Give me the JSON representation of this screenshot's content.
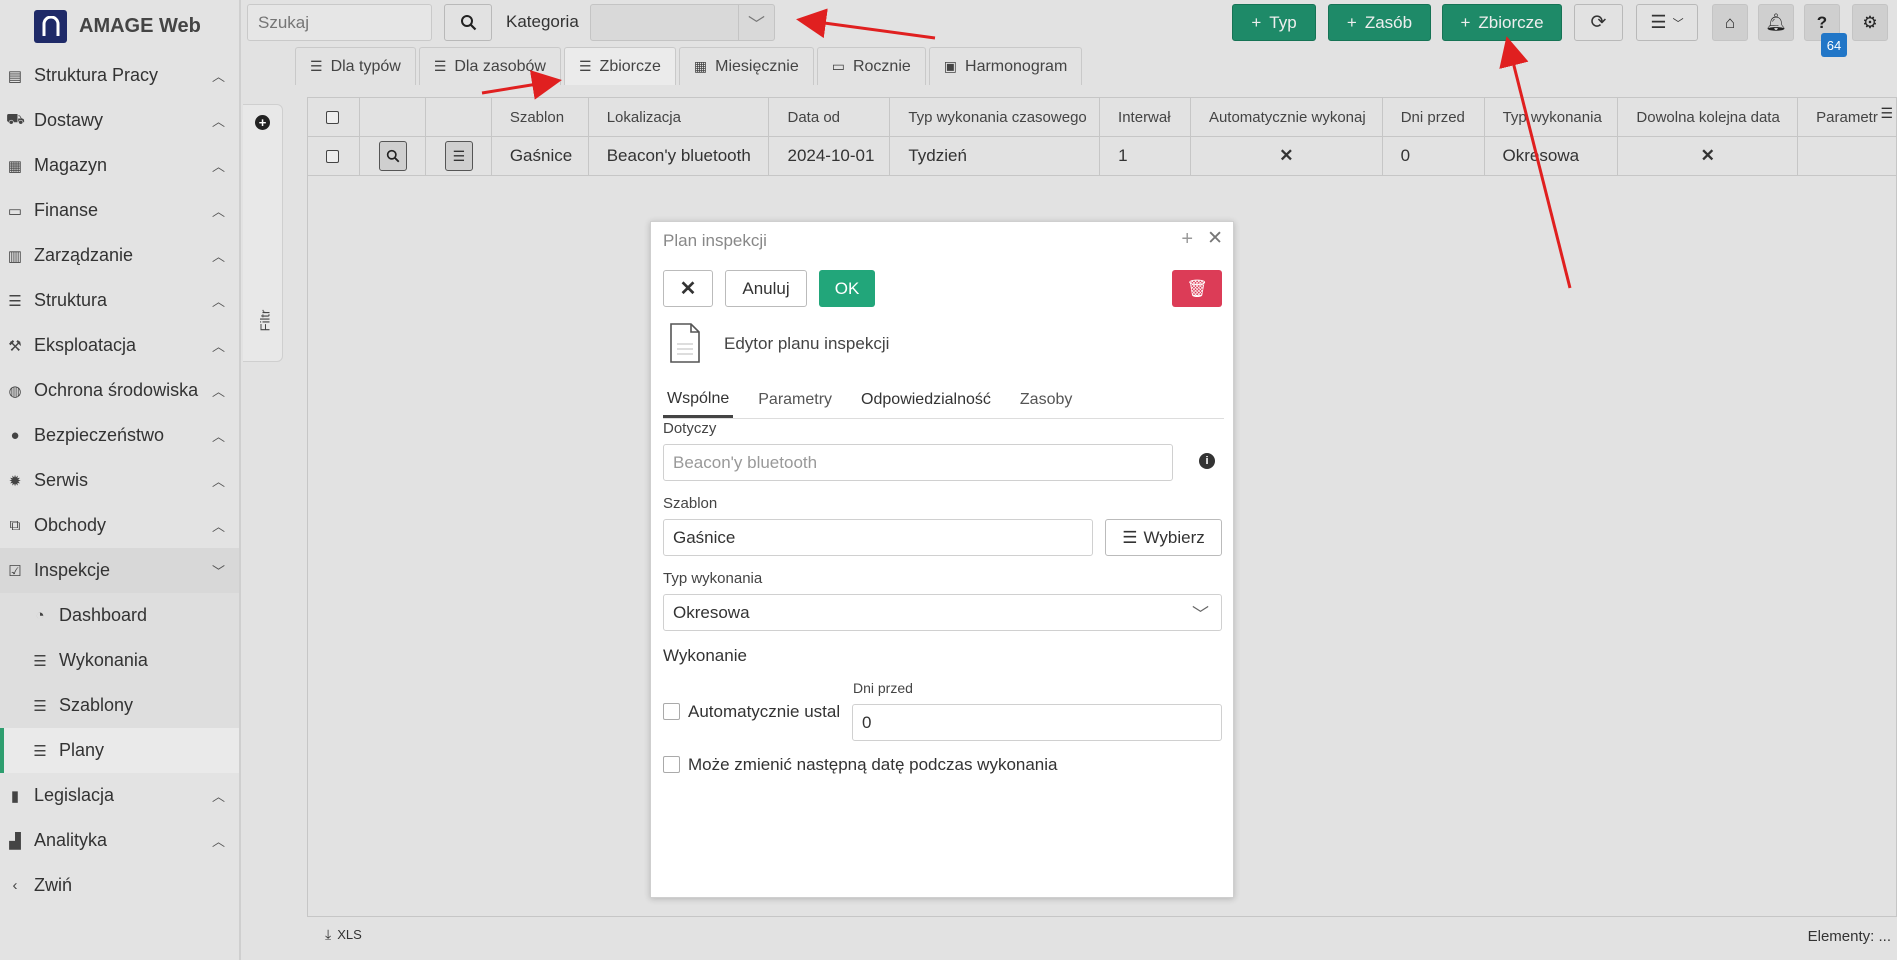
{
  "app": {
    "title": "AMAGE Web"
  },
  "sidebar": {
    "items": [
      {
        "label": "Struktura Pracy",
        "icon": "tasks-icon"
      },
      {
        "label": "Dostawy",
        "icon": "truck-icon"
      },
      {
        "label": "Magazyn",
        "icon": "warehouse-icon"
      },
      {
        "label": "Finanse",
        "icon": "money-icon"
      },
      {
        "label": "Zarządzanie",
        "icon": "building-icon"
      },
      {
        "label": "Struktura",
        "icon": "list-icon"
      },
      {
        "label": "Eksploatacja",
        "icon": "tool-icon"
      },
      {
        "label": "Ochrona środowiska",
        "icon": "globe-icon"
      },
      {
        "label": "Bezpieczeństwo",
        "icon": "user-shield-icon"
      },
      {
        "label": "Serwis",
        "icon": "bug-icon"
      },
      {
        "label": "Obchody",
        "icon": "route-icon"
      },
      {
        "label": "Inspekcje",
        "icon": "check-square-icon"
      },
      {
        "label": "Dashboard",
        "icon": "gauge-icon"
      },
      {
        "label": "Wykonania",
        "icon": "list-icon"
      },
      {
        "label": "Szablony",
        "icon": "list-icon"
      },
      {
        "label": "Plany",
        "icon": "list-icon"
      },
      {
        "label": "Legislacja",
        "icon": "book-icon"
      },
      {
        "label": "Analityka",
        "icon": "chart-icon"
      },
      {
        "label": "Zwiń",
        "icon": "chevron-left-icon"
      }
    ],
    "filter_label": "Filtr"
  },
  "topbar": {
    "search_placeholder": "Szukaj",
    "category_label": "Kategoria",
    "btn_typ": "Typ",
    "btn_zasob": "Zasób",
    "btn_zbiorcze": "Zbiorcze",
    "badge": "64"
  },
  "tabs": [
    "Dla typów",
    "Dla zasobów",
    "Zbiorcze",
    "Miesięcznie",
    "Rocznie",
    "Harmonogram"
  ],
  "grid": {
    "headers": [
      "Szablon",
      "Lokalizacja",
      "Data od",
      "Typ wykonania czasowego",
      "Interwał",
      "Automatycznie wykonaj",
      "Dni przed",
      "Typ wykonania",
      "Dowolna kolejna data",
      "Parametr"
    ],
    "row": {
      "szablon": "Gaśnice",
      "lokalizacja": "Beacon'y bluetooth",
      "data_od": "2024-10-01",
      "typ_czas": "Tydzień",
      "interwal": "1",
      "auto": "✕",
      "dni_przed": "0",
      "typ_wykonania": "Okresowa",
      "dowolna": "✕"
    }
  },
  "footer": {
    "xls": "XLS",
    "elements": "Elementy:",
    "elements_value": "..."
  },
  "modal": {
    "title": "Plan inspekcji",
    "cancel": "Anuluj",
    "ok": "OK",
    "subtitle": "Edytor planu inspekcji",
    "tabs": [
      "Wspólne",
      "Parametry",
      "Odpowiedzialność",
      "Zasoby"
    ],
    "dotyczy_label": "Dotyczy",
    "dotyczy_value": "Beacon'y bluetooth",
    "szablon_label": "Szablon",
    "szablon_value": "Gaśnice",
    "wybierz": "Wybierz",
    "typ_label": "Typ wykonania",
    "typ_value": "Okresowa",
    "wykonanie_label": "Wykonanie",
    "auto_label": "Automatycznie ustal",
    "dni_label": "Dni przed",
    "dni_value": "0",
    "moze_label": "Może zmienić następną datę podczas wykonania"
  }
}
